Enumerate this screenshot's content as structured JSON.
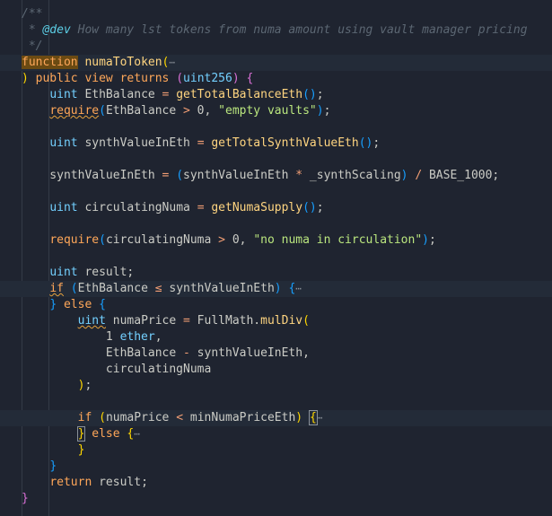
{
  "editor": {
    "lines": [
      {
        "id": "l1",
        "segs": [
          {
            "t": "/**",
            "c": "c-com"
          }
        ]
      },
      {
        "id": "l2",
        "segs": [
          {
            "t": " * ",
            "c": "c-com"
          },
          {
            "t": "@dev",
            "c": "c-tag"
          },
          {
            "t": " How many lst tokens from numa amount using vault manager pricing",
            "c": "c-com"
          }
        ]
      },
      {
        "id": "l3",
        "segs": [
          {
            "t": " */",
            "c": "c-com"
          }
        ]
      },
      {
        "id": "l4",
        "hl": true,
        "segs": [
          {
            "t": "function",
            "c": "c-kw kw-highlight"
          },
          {
            "t": " ",
            "c": "c-id"
          },
          {
            "t": "numaToToken",
            "c": "c-fn"
          },
          {
            "t": "(",
            "c": "b1"
          },
          {
            "t": "⋯",
            "c": "fold"
          }
        ]
      },
      {
        "id": "l5",
        "segs": [
          {
            "t": ") ",
            "c": "b1"
          },
          {
            "t": "public",
            "c": "c-kw"
          },
          {
            "t": " ",
            "c": "c-id"
          },
          {
            "t": "view",
            "c": "c-kw"
          },
          {
            "t": " ",
            "c": "c-id"
          },
          {
            "t": "returns",
            "c": "c-kw"
          },
          {
            "t": " ",
            "c": "c-id"
          },
          {
            "t": "(",
            "c": "b2"
          },
          {
            "t": "uint256",
            "c": "c-ty"
          },
          {
            "t": ")",
            "c": "b2"
          },
          {
            "t": " ",
            "c": "c-id"
          },
          {
            "t": "{",
            "c": "b2"
          }
        ]
      },
      {
        "id": "l6",
        "segs": [
          {
            "t": "    ",
            "c": "c-id"
          },
          {
            "t": "uint",
            "c": "c-ty"
          },
          {
            "t": " EthBalance ",
            "c": "c-id"
          },
          {
            "t": "=",
            "c": "c-op"
          },
          {
            "t": " ",
            "c": "c-id"
          },
          {
            "t": "getTotalBalanceEth",
            "c": "c-fn"
          },
          {
            "t": "()",
            "c": "b3"
          },
          {
            "t": ";",
            "c": "c-id"
          }
        ]
      },
      {
        "id": "l7",
        "segs": [
          {
            "t": "    ",
            "c": "c-id"
          },
          {
            "t": "require",
            "c": "c-kw squiggle"
          },
          {
            "t": "(",
            "c": "b3"
          },
          {
            "t": "EthBalance ",
            "c": "c-id"
          },
          {
            "t": ">",
            "c": "c-op"
          },
          {
            "t": " 0, ",
            "c": "c-num"
          },
          {
            "t": "\"empty vaults\"",
            "c": "c-str"
          },
          {
            "t": ")",
            "c": "b3"
          },
          {
            "t": ";",
            "c": "c-id"
          }
        ]
      },
      {
        "id": "l8",
        "segs": []
      },
      {
        "id": "l9",
        "segs": [
          {
            "t": "    ",
            "c": "c-id"
          },
          {
            "t": "uint",
            "c": "c-ty"
          },
          {
            "t": " synthValueInEth ",
            "c": "c-id"
          },
          {
            "t": "=",
            "c": "c-op"
          },
          {
            "t": " ",
            "c": "c-id"
          },
          {
            "t": "getTotalSynthValueEth",
            "c": "c-fn"
          },
          {
            "t": "()",
            "c": "b3"
          },
          {
            "t": ";",
            "c": "c-id"
          }
        ]
      },
      {
        "id": "l10",
        "segs": []
      },
      {
        "id": "l11",
        "segs": [
          {
            "t": "    synthValueInEth ",
            "c": "c-id"
          },
          {
            "t": "=",
            "c": "c-op"
          },
          {
            "t": " ",
            "c": "c-id"
          },
          {
            "t": "(",
            "c": "b3"
          },
          {
            "t": "synthValueInEth ",
            "c": "c-id"
          },
          {
            "t": "*",
            "c": "c-op"
          },
          {
            "t": " _synthScaling",
            "c": "c-id"
          },
          {
            "t": ")",
            "c": "b3"
          },
          {
            "t": " ",
            "c": "c-id"
          },
          {
            "t": "/",
            "c": "c-op"
          },
          {
            "t": " BASE_1000;",
            "c": "c-id"
          }
        ]
      },
      {
        "id": "l12",
        "segs": []
      },
      {
        "id": "l13",
        "segs": [
          {
            "t": "    ",
            "c": "c-id"
          },
          {
            "t": "uint",
            "c": "c-ty"
          },
          {
            "t": " circulatingNuma ",
            "c": "c-id"
          },
          {
            "t": "=",
            "c": "c-op"
          },
          {
            "t": " ",
            "c": "c-id"
          },
          {
            "t": "getNumaSupply",
            "c": "c-fn"
          },
          {
            "t": "()",
            "c": "b3"
          },
          {
            "t": ";",
            "c": "c-id"
          }
        ]
      },
      {
        "id": "l14",
        "segs": []
      },
      {
        "id": "l15",
        "segs": [
          {
            "t": "    ",
            "c": "c-id"
          },
          {
            "t": "require",
            "c": "c-kw"
          },
          {
            "t": "(",
            "c": "b3"
          },
          {
            "t": "circulatingNuma ",
            "c": "c-id"
          },
          {
            "t": ">",
            "c": "c-op"
          },
          {
            "t": " 0, ",
            "c": "c-num"
          },
          {
            "t": "\"no numa in circulation\"",
            "c": "c-str"
          },
          {
            "t": ")",
            "c": "b3"
          },
          {
            "t": ";",
            "c": "c-id"
          }
        ]
      },
      {
        "id": "l16",
        "segs": []
      },
      {
        "id": "l17",
        "segs": [
          {
            "t": "    ",
            "c": "c-id"
          },
          {
            "t": "uint",
            "c": "c-ty"
          },
          {
            "t": " result;",
            "c": "c-id"
          }
        ]
      },
      {
        "id": "l18",
        "hl": true,
        "segs": [
          {
            "t": "    ",
            "c": "c-id"
          },
          {
            "t": "if",
            "c": "c-kw squiggle"
          },
          {
            "t": " ",
            "c": "c-id"
          },
          {
            "t": "(",
            "c": "b3"
          },
          {
            "t": "EthBalance ",
            "c": "c-id"
          },
          {
            "t": "≤",
            "c": "c-op"
          },
          {
            "t": " synthValueInEth",
            "c": "c-id"
          },
          {
            "t": ")",
            "c": "b3"
          },
          {
            "t": " ",
            "c": "c-id"
          },
          {
            "t": "{",
            "c": "b3"
          },
          {
            "t": "⋯",
            "c": "fold"
          }
        ]
      },
      {
        "id": "l19",
        "segs": [
          {
            "t": "    ",
            "c": "c-id"
          },
          {
            "t": "}",
            "c": "b3"
          },
          {
            "t": " ",
            "c": "c-id"
          },
          {
            "t": "else",
            "c": "c-kw"
          },
          {
            "t": " ",
            "c": "c-id"
          },
          {
            "t": "{",
            "c": "b3"
          }
        ]
      },
      {
        "id": "l20",
        "segs": [
          {
            "t": "        ",
            "c": "c-id"
          },
          {
            "t": "uint",
            "c": "c-ty squiggle"
          },
          {
            "t": " numaPrice ",
            "c": "c-id"
          },
          {
            "t": "=",
            "c": "c-op"
          },
          {
            "t": " FullMath.",
            "c": "c-id"
          },
          {
            "t": "mulDiv",
            "c": "c-fn"
          },
          {
            "t": "(",
            "c": "b1"
          }
        ]
      },
      {
        "id": "l21",
        "segs": [
          {
            "t": "            1 ",
            "c": "c-num"
          },
          {
            "t": "ether",
            "c": "c-ty"
          },
          {
            "t": ",",
            "c": "c-id"
          }
        ]
      },
      {
        "id": "l22",
        "segs": [
          {
            "t": "            EthBalance ",
            "c": "c-id"
          },
          {
            "t": "-",
            "c": "c-op"
          },
          {
            "t": " synthValueInEth,",
            "c": "c-id"
          }
        ]
      },
      {
        "id": "l23",
        "segs": [
          {
            "t": "            circulatingNuma",
            "c": "c-id"
          }
        ]
      },
      {
        "id": "l24",
        "segs": [
          {
            "t": "        ",
            "c": "c-id"
          },
          {
            "t": ")",
            "c": "b1"
          },
          {
            "t": ";",
            "c": "c-id"
          }
        ]
      },
      {
        "id": "l25",
        "segs": []
      },
      {
        "id": "l26",
        "hl": true,
        "segs": [
          {
            "t": "        ",
            "c": "c-id"
          },
          {
            "t": "if",
            "c": "c-kw"
          },
          {
            "t": " ",
            "c": "c-id"
          },
          {
            "t": "(",
            "c": "b1"
          },
          {
            "t": "numaPrice ",
            "c": "c-id"
          },
          {
            "t": "<",
            "c": "c-op"
          },
          {
            "t": " minNumaPriceEth",
            "c": "c-id"
          },
          {
            "t": ")",
            "c": "b1"
          },
          {
            "t": " ",
            "c": "c-id"
          },
          {
            "t": "{",
            "c": "b1 match-box"
          },
          {
            "t": "⋯",
            "c": "fold"
          }
        ]
      },
      {
        "id": "l27",
        "segs": [
          {
            "t": "        ",
            "c": "c-id"
          },
          {
            "t": "}",
            "c": "b1 match-box"
          },
          {
            "t": " ",
            "c": "c-id"
          },
          {
            "t": "else",
            "c": "c-kw"
          },
          {
            "t": " ",
            "c": "c-id"
          },
          {
            "t": "{",
            "c": "b1"
          },
          {
            "t": "⋯",
            "c": "fold"
          }
        ]
      },
      {
        "id": "l28",
        "segs": [
          {
            "t": "        ",
            "c": "c-id"
          },
          {
            "t": "}",
            "c": "b1"
          }
        ]
      },
      {
        "id": "l29",
        "segs": [
          {
            "t": "    ",
            "c": "c-id"
          },
          {
            "t": "}",
            "c": "b3"
          }
        ]
      },
      {
        "id": "l30",
        "segs": [
          {
            "t": "    ",
            "c": "c-id"
          },
          {
            "t": "return",
            "c": "c-kw"
          },
          {
            "t": " result;",
            "c": "c-id"
          }
        ]
      },
      {
        "id": "l31",
        "segs": [
          {
            "t": "}",
            "c": "b2"
          }
        ]
      }
    ]
  }
}
